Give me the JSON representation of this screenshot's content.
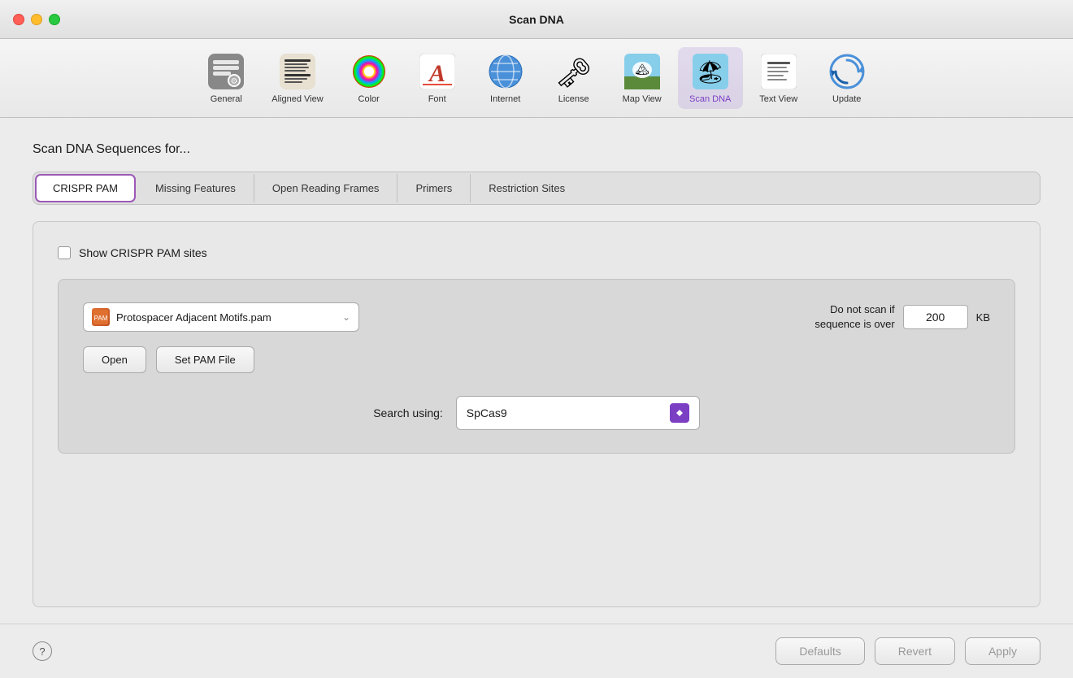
{
  "window": {
    "title": "Scan DNA"
  },
  "toolbar": {
    "items": [
      {
        "id": "general",
        "label": "General",
        "icon": "⚙",
        "active": false,
        "iconType": "gray-square"
      },
      {
        "id": "aligned-view",
        "label": "Aligned View",
        "icon": "≡",
        "active": false,
        "iconType": "text-lines"
      },
      {
        "id": "color",
        "label": "Color",
        "icon": "◉",
        "active": false,
        "iconType": "color-wheel"
      },
      {
        "id": "font",
        "label": "Font",
        "icon": "A",
        "active": false,
        "iconType": "font"
      },
      {
        "id": "internet",
        "label": "Internet",
        "icon": "🌐",
        "active": false,
        "iconType": "globe"
      },
      {
        "id": "license",
        "label": "License",
        "icon": "🔑",
        "active": false,
        "iconType": "keys"
      },
      {
        "id": "map-view",
        "label": "Map View",
        "icon": "🖼",
        "active": false,
        "iconType": "photo"
      },
      {
        "id": "scan-dna",
        "label": "Scan DNA",
        "icon": "🧬",
        "active": true,
        "iconType": "scan-dna"
      },
      {
        "id": "text-view",
        "label": "Text View",
        "icon": "📄",
        "active": false,
        "iconType": "document"
      },
      {
        "id": "update",
        "label": "Update",
        "icon": "🔄",
        "active": false,
        "iconType": "update"
      }
    ]
  },
  "main": {
    "section_title": "Scan DNA Sequences for...",
    "tabs": [
      {
        "id": "crispr-pam",
        "label": "CRISPR PAM",
        "active": true
      },
      {
        "id": "missing-features",
        "label": "Missing Features",
        "active": false
      },
      {
        "id": "open-reading-frames",
        "label": "Open Reading Frames",
        "active": false
      },
      {
        "id": "primers",
        "label": "Primers",
        "active": false
      },
      {
        "id": "restriction-sites",
        "label": "Restriction Sites",
        "active": false
      }
    ],
    "panel": {
      "checkbox_label": "Show CRISPR PAM sites",
      "checkbox_checked": false,
      "pam_file": "Protospacer Adjacent Motifs.pam",
      "scan_limit_label_line1": "Do not scan if",
      "scan_limit_label_line2": "sequence is over",
      "scan_limit_value": "200",
      "scan_limit_unit": "KB",
      "btn_open": "Open",
      "btn_set_pam": "Set PAM File",
      "search_label": "Search using:",
      "search_value": "SpCas9"
    }
  },
  "bottom": {
    "help_label": "?",
    "btn_defaults": "Defaults",
    "btn_revert": "Revert",
    "btn_apply": "Apply"
  }
}
